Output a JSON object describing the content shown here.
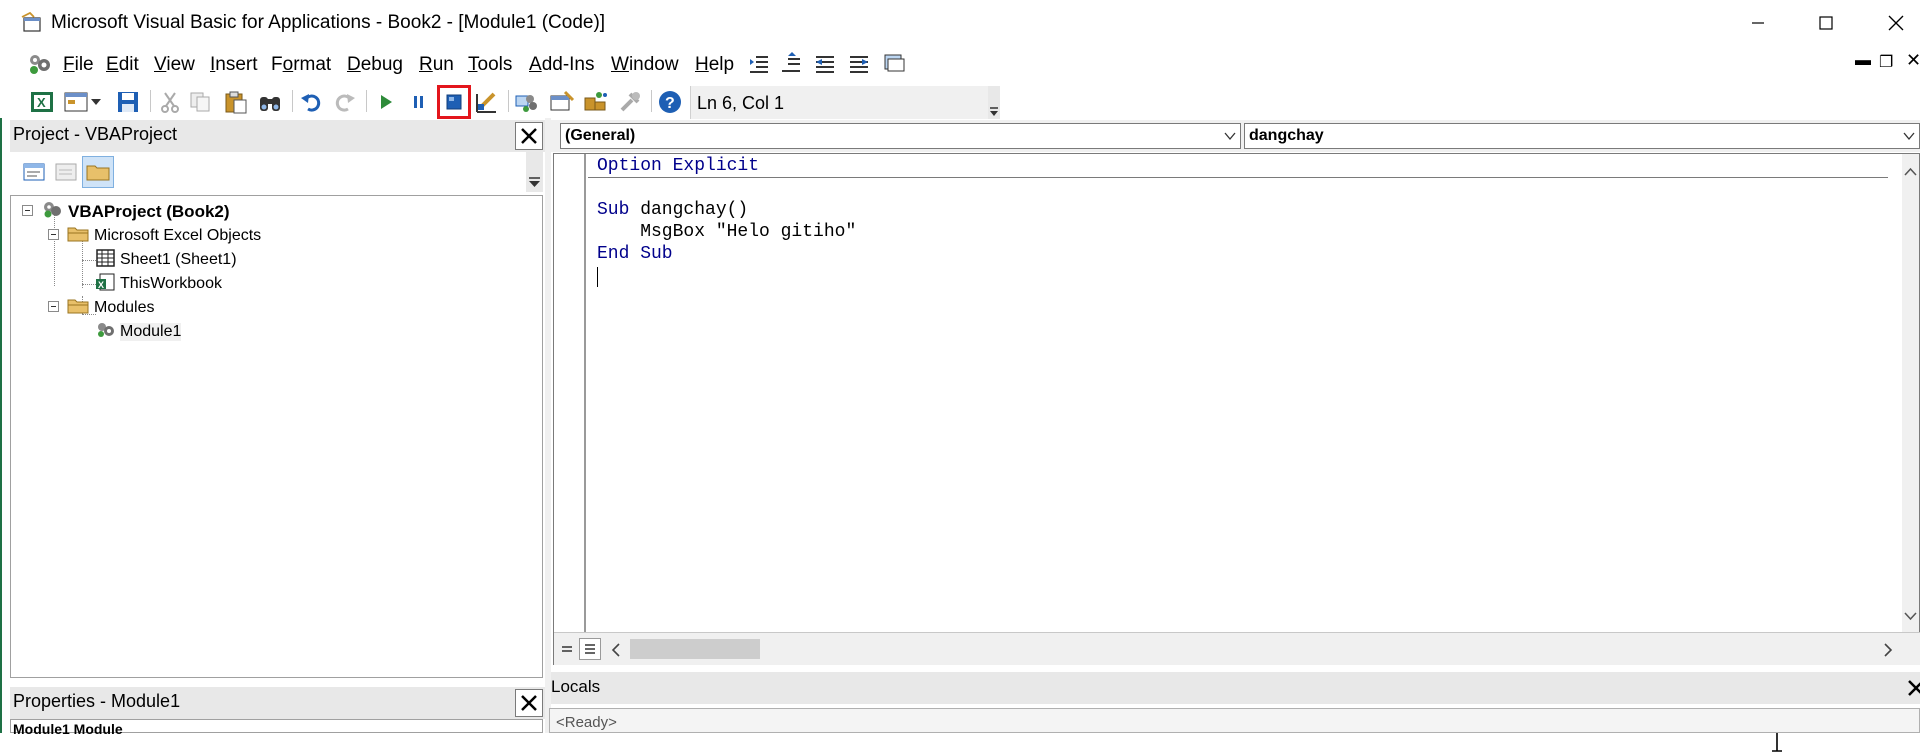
{
  "window": {
    "title": "Microsoft Visual Basic for Applications - Book2 - [Module1 (Code)]"
  },
  "menu": {
    "items": [
      {
        "label": "File",
        "ul": "F",
        "rest": "ile"
      },
      {
        "label": "Edit",
        "ul": "E",
        "rest": "dit"
      },
      {
        "label": "View",
        "ul": "V",
        "rest": "iew"
      },
      {
        "label": "Insert",
        "ul": "I",
        "rest": "nsert"
      },
      {
        "label": "Format",
        "ul": "",
        "pre": "F",
        "mid": "o",
        "post": "rmat"
      },
      {
        "label": "Debug",
        "ul": "D",
        "rest": "ebug"
      },
      {
        "label": "Run",
        "ul": "R",
        "rest": "un"
      },
      {
        "label": "Tools",
        "ul": "T",
        "rest": "ools"
      },
      {
        "label": "Add-Ins",
        "ul": "A",
        "rest": "dd-Ins"
      },
      {
        "label": "Window",
        "ul": "W",
        "rest": "indow"
      },
      {
        "label": "Help",
        "ul": "H",
        "rest": "elp"
      }
    ]
  },
  "toolbar": {
    "position_text": "Ln 6, Col 1",
    "highlighted_button": "reset-stop-icon",
    "highlight_color": "#e3161c"
  },
  "project_panel": {
    "title": "Project - VBAProject",
    "tree": {
      "root": "VBAProject (Book2)",
      "folder_objects": "Microsoft Excel Objects",
      "sheet1": "Sheet1 (Sheet1)",
      "thisworkbook": "ThisWorkbook",
      "folder_modules": "Modules",
      "module1": "Module1"
    }
  },
  "properties_panel": {
    "title": "Properties - Module1",
    "partial_text": "Module1 Module"
  },
  "code_window": {
    "object_combo": "(General)",
    "procedure_combo": "dangchay",
    "lines": {
      "line1_kw": "Option Explicit",
      "line3_kw": "Sub",
      "line3_rest": " dangchay()",
      "line4": "    MsgBox \"Helo gitiho\"",
      "line5_kw": "End Sub"
    },
    "keyword_color": "#00008b"
  },
  "locals": {
    "title": "Locals",
    "status": "<Ready>"
  }
}
